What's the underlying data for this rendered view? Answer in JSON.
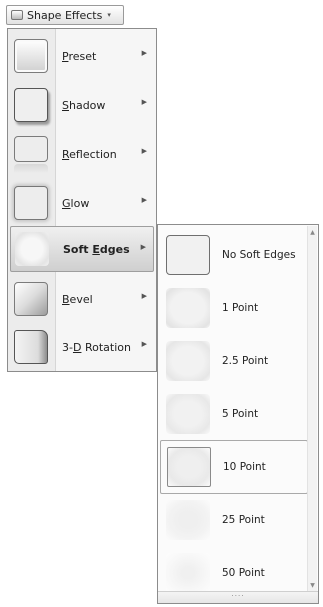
{
  "ribbon_button": {
    "label": "Shape Effects",
    "caret": "▾"
  },
  "menu": {
    "items": [
      {
        "pre": "",
        "key": "P",
        "post": "reset",
        "thumb": "t-preset"
      },
      {
        "pre": "",
        "key": "S",
        "post": "hadow",
        "thumb": "t-shadow"
      },
      {
        "pre": "",
        "key": "R",
        "post": "eflection",
        "thumb": "t-reflection"
      },
      {
        "pre": "",
        "key": "G",
        "post": "low",
        "thumb": "t-glow"
      },
      {
        "pre": "Soft ",
        "key": "E",
        "post": "dges",
        "thumb": "t-soft"
      },
      {
        "pre": "",
        "key": "B",
        "post": "evel",
        "thumb": "t-bevel"
      },
      {
        "pre": "3-",
        "key": "D",
        "post": " Rotation",
        "thumb": "t-3d"
      }
    ],
    "arrow": "▶",
    "active_index": 4
  },
  "submenu": {
    "items": [
      {
        "label": "No Soft Edges"
      },
      {
        "label": "1 Point"
      },
      {
        "label": "2.5 Point"
      },
      {
        "label": "5 Point"
      },
      {
        "label": "10 Point"
      },
      {
        "label": "25 Point"
      },
      {
        "label": "50 Point"
      }
    ],
    "hover_index": 4
  },
  "scrollbar": {
    "up": "▲",
    "down": "▼",
    "grip": "····"
  }
}
